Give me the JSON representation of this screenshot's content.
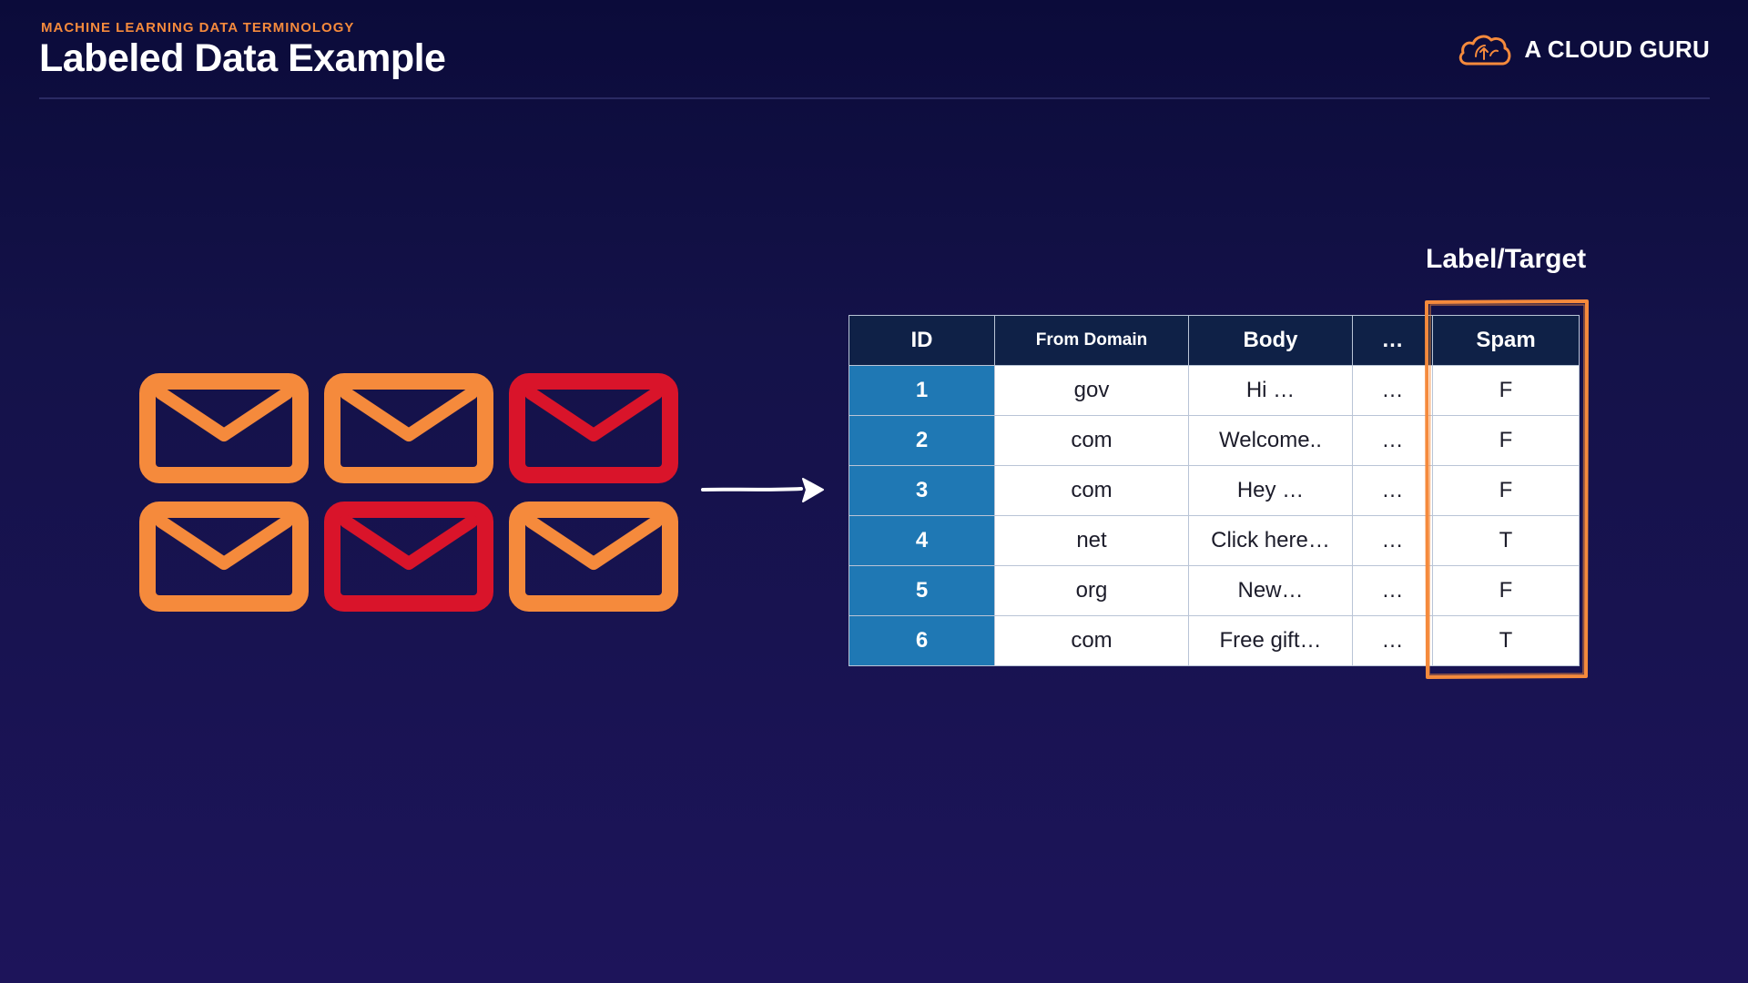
{
  "header": {
    "eyebrow": "MACHINE LEARNING DATA TERMINOLOGY",
    "title": "Labeled Data Example"
  },
  "brand": {
    "name": "A CLOUD GURU",
    "icon": "cloud-logo-icon",
    "color": "#f58a3c"
  },
  "colors": {
    "normal_email": "#f58a3c",
    "spam_email": "#d9142a",
    "id_column": "#1f78b4",
    "header_row": "#0f2147",
    "target_highlight": "#f58a3c"
  },
  "envelopes": [
    {
      "status": "normal",
      "icon": "envelope-icon"
    },
    {
      "status": "normal",
      "icon": "envelope-icon"
    },
    {
      "status": "spam",
      "icon": "envelope-icon"
    },
    {
      "status": "normal",
      "icon": "envelope-icon"
    },
    {
      "status": "spam",
      "icon": "envelope-icon"
    },
    {
      "status": "normal",
      "icon": "envelope-icon"
    }
  ],
  "arrow_icon": "arrow-right-icon",
  "label_target": "Label/Target",
  "table": {
    "columns": [
      "ID",
      "From Domain",
      "Body",
      "…",
      "Spam"
    ],
    "rows": [
      [
        "1",
        "gov",
        "Hi …",
        "…",
        "F"
      ],
      [
        "2",
        "com",
        "Welcome..",
        "…",
        "F"
      ],
      [
        "3",
        "com",
        "Hey …",
        "…",
        "F"
      ],
      [
        "4",
        "net",
        "Click here…",
        "…",
        "T"
      ],
      [
        "5",
        "org",
        "New…",
        "…",
        "F"
      ],
      [
        "6",
        "com",
        "Free gift…",
        "…",
        "T"
      ]
    ]
  }
}
